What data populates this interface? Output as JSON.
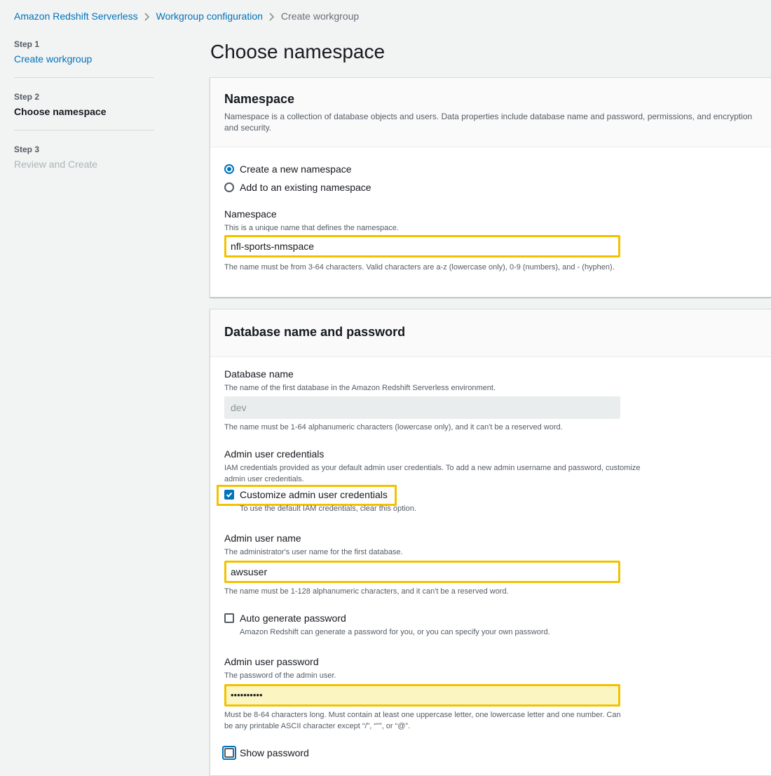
{
  "breadcrumb": {
    "items": [
      "Amazon Redshift Serverless",
      "Workgroup configuration"
    ],
    "current": "Create workgroup"
  },
  "steps": [
    {
      "num": "Step 1",
      "label": "Create workgroup"
    },
    {
      "num": "Step 2",
      "label": "Choose namespace"
    },
    {
      "num": "Step 3",
      "label": "Review and Create"
    }
  ],
  "page": {
    "title": "Choose namespace"
  },
  "namespace_panel": {
    "title": "Namespace",
    "description": "Namespace is a collection of database objects and users. Data properties include database name and password, permissions, and encryption and security.",
    "options": [
      "Create a new namespace",
      "Add to an existing namespace"
    ],
    "selected": 0,
    "field_label": "Namespace",
    "field_desc": "This is a unique name that defines the namespace.",
    "field_value": "nfl-sports-nmspace",
    "field_hint": "The name must be from 3-64 characters. Valid characters are a-z (lowercase only), 0-9 (numbers), and - (hyphen)."
  },
  "db_panel": {
    "title": "Database name and password",
    "db_label": "Database name",
    "db_desc": "The name of the first database in the Amazon Redshift Serverless environment.",
    "db_value": "dev",
    "db_hint": "The name must be 1-64 alphanumeric characters (lowercase only), and it can't be a reserved word.",
    "admin_cred_label": "Admin user credentials",
    "admin_cred_desc": "IAM credentials provided as your default admin user credentials. To add a new admin username and password, customize admin user credentials.",
    "customize_label": "Customize admin user credentials",
    "customize_checked": true,
    "customize_hint": "To use the default IAM credentials, clear this option.",
    "admin_name_label": "Admin user name",
    "admin_name_desc": "The administrator's user name for the first database.",
    "admin_name_value": "awsuser",
    "admin_name_hint": "The name must be 1-128 alphanumeric characters, and it can't be a reserved word.",
    "auto_pw_label": "Auto generate password",
    "auto_pw_checked": false,
    "auto_pw_hint": "Amazon Redshift can generate a password for you, or you can specify your own password.",
    "pw_label": "Admin user password",
    "pw_desc": "The password of the admin user.",
    "pw_value": "••••••••••",
    "pw_hint": "Must be 8-64 characters long. Must contain at least one uppercase letter, one lowercase letter and one number. Can be any printable ASCII character except “/”, “\"”, or “@”.",
    "show_pw_label": "Show password",
    "show_pw_checked": false
  },
  "colors": {
    "link": "#0073bb",
    "highlight": "#f2c200",
    "password_fill": "#fbf5c2"
  }
}
